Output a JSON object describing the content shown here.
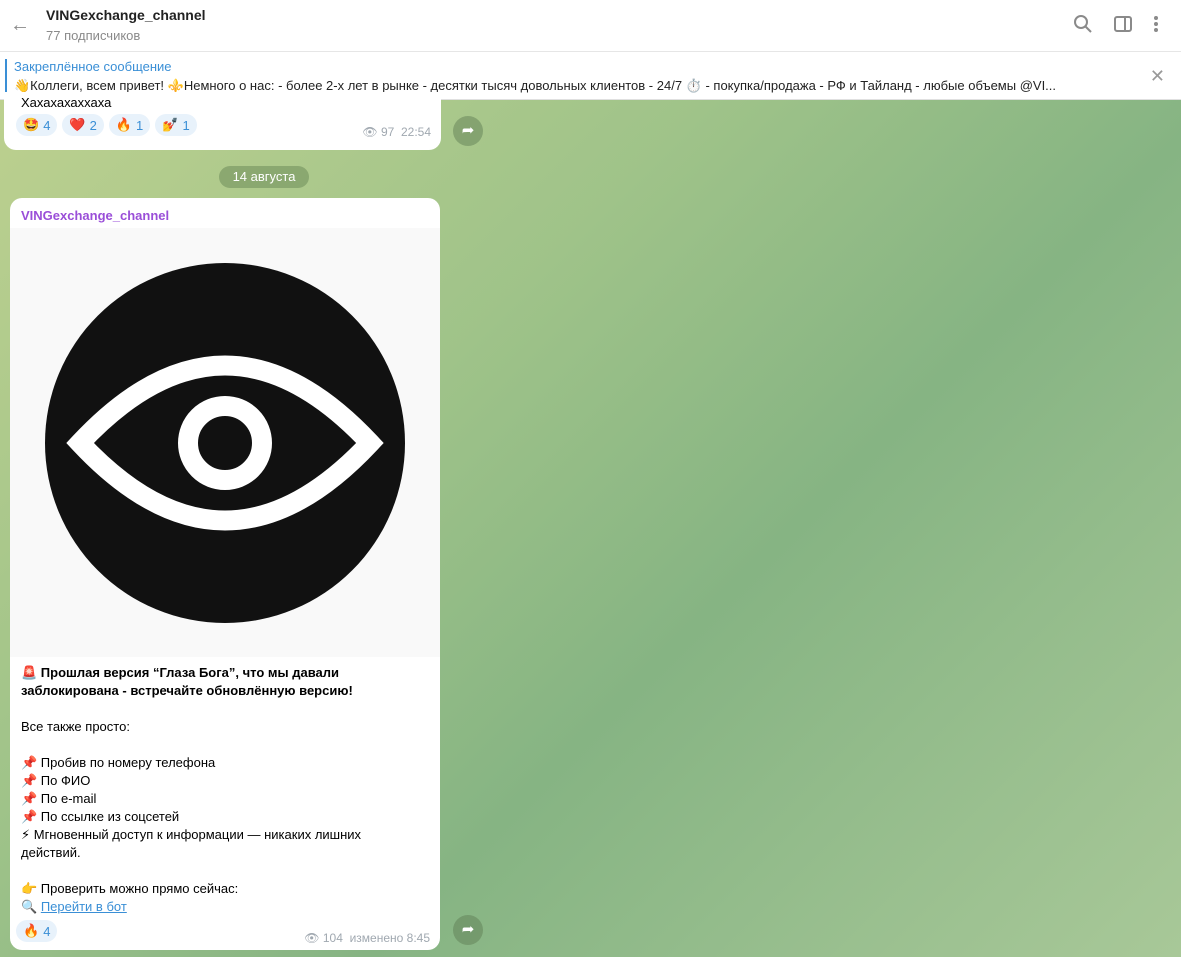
{
  "header": {
    "title": "VINGexchange_channel",
    "subtitle": "77 подписчиков"
  },
  "pinned": {
    "title": "Закреплённое сообщение",
    "text": "👋Коллеги, всем привет!  ⚜️Немного о нас:  - более 2-х лет в рынке  - десятки тысяч довольных клиентов   - 24/7 ⏱️  - покупка/продажа  - РФ и Тайланд  - любые объемы  @VI..."
  },
  "message1": {
    "text": "Хахахахаххаха",
    "reactions": [
      {
        "emoji": "🤩",
        "count": "4"
      },
      {
        "emoji": "❤️",
        "count": "2"
      },
      {
        "emoji": "🔥",
        "count": "1"
      },
      {
        "emoji": "💅",
        "count": "1"
      }
    ],
    "views": "97",
    "time": "22:54"
  },
  "date_separator": "14 августа",
  "message2": {
    "sender": "VINGexchange_channel",
    "lines": [
      "🚨 Прошлая версия  “Глаза Бога”, что мы давали",
      "заблокирована - встречайте обновлённую версию!",
      "",
      "Все также просто:",
      "",
      "📌 Пробив по номеру телефона",
      "📌 По ФИО",
      "📌 По e-mail",
      "📌 По ссылке из соцсетей",
      "⚡ Мгновенный доступ к информации — никаких лишних",
      "действий.",
      "",
      "👉 Проверить можно прямо сейчас:"
    ],
    "link_emoji": "🔍",
    "link_text": "Перейти в бот",
    "reactions": [
      {
        "emoji": "🔥",
        "count": "4"
      }
    ],
    "views": "104",
    "time": "изменено 8:45"
  }
}
